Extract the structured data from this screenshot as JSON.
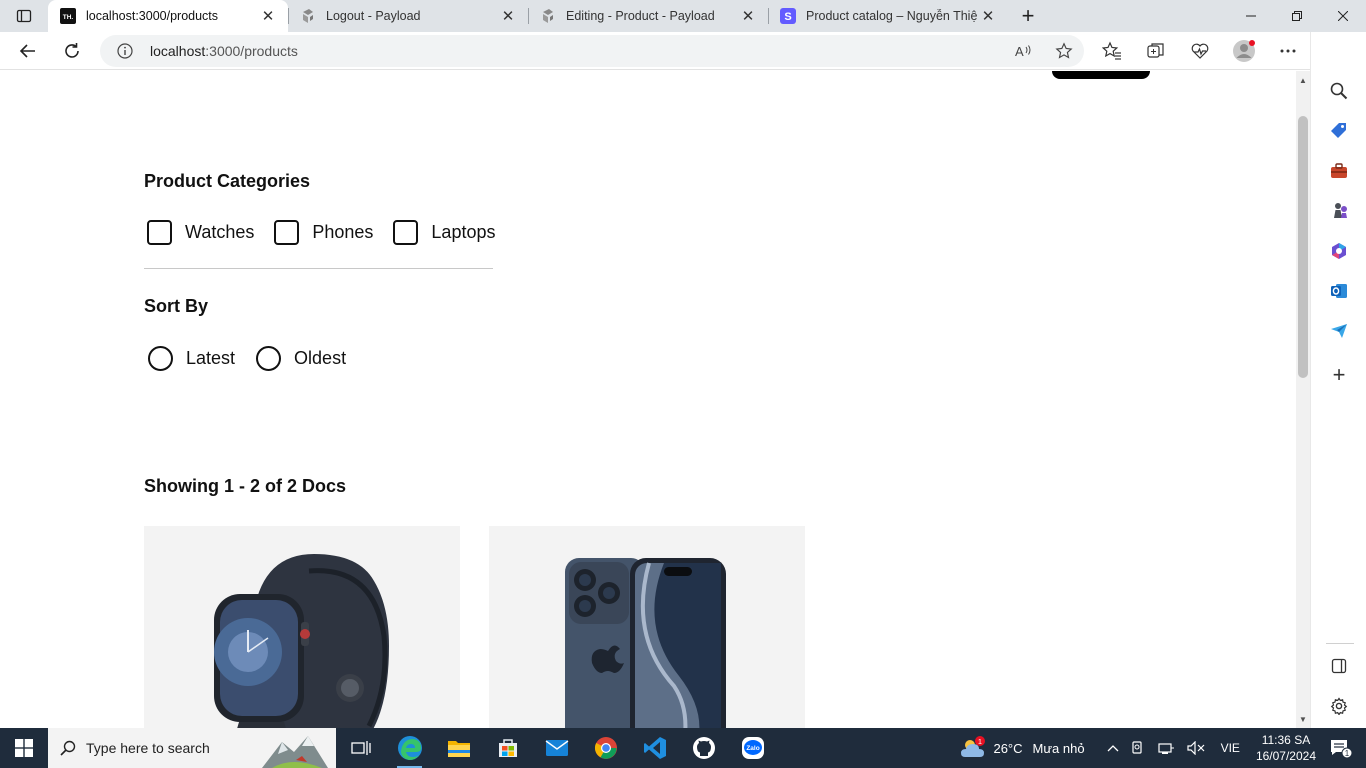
{
  "browser": {
    "tabs": [
      {
        "title": "localhost:3000/products",
        "favicon": "th-logo",
        "active": true
      },
      {
        "title": "Logout - Payload",
        "favicon": "payload-logo",
        "active": false
      },
      {
        "title": "Editing - Product - Payload",
        "favicon": "payload-logo",
        "active": false
      },
      {
        "title": "Product catalog – Nguyễn Thiện",
        "favicon": "stripe-logo",
        "active": false
      }
    ],
    "address": {
      "host": "localhost",
      "path": ":3000/products"
    }
  },
  "page": {
    "categories_title": "Product Categories",
    "categories": [
      "Watches",
      "Phones",
      "Laptops"
    ],
    "sort_title": "Sort By",
    "sort_options": [
      "Latest",
      "Oldest"
    ],
    "results_summary": "Showing 1 - 2 of 2 Docs",
    "products": [
      {
        "image": "apple-watch-image"
      },
      {
        "image": "iphone-image"
      }
    ]
  },
  "taskbar": {
    "search_placeholder": "Type here to search",
    "weather_temp": "26°C",
    "weather_desc": "Mưa nhỏ",
    "weather_badge": "1",
    "language": "VIE",
    "time": "11:36 SA",
    "date": "16/07/2024",
    "notification_count": "1"
  },
  "colors": {
    "accent": "#0078d4",
    "taskbar": "#1f2c3c",
    "card_bg": "#f3f3f3"
  }
}
